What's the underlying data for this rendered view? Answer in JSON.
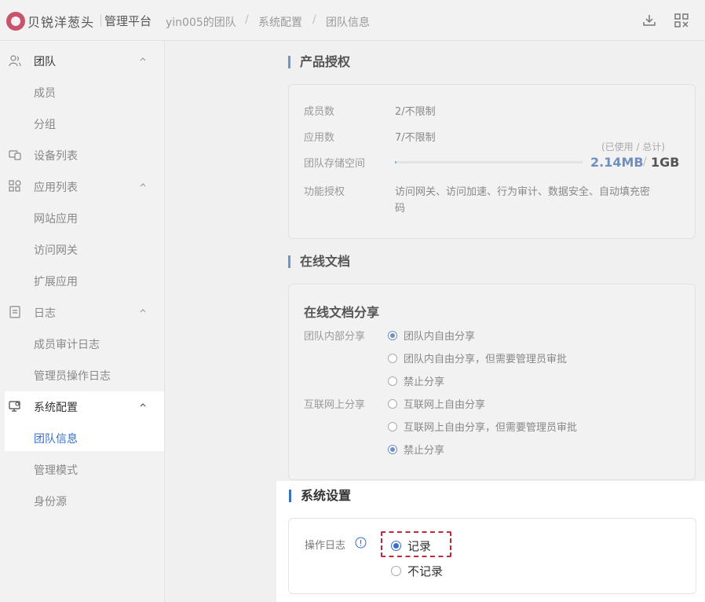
{
  "header": {
    "brand": "贝锐洋葱头",
    "platform": "管理平台",
    "breadcrumb": [
      "yin005的团队",
      "系统配置",
      "团队信息"
    ],
    "breadcrumb_sep": "/",
    "icons": [
      "download-icon",
      "qrcode-icon"
    ]
  },
  "sidebar": {
    "items": [
      {
        "label": "团队",
        "icon": "team-icon",
        "expandable": true
      },
      {
        "label": "成员"
      },
      {
        "label": "分组"
      },
      {
        "label": "设备列表",
        "icon": "devices-icon"
      },
      {
        "label": "应用列表",
        "icon": "apps-icon",
        "expandable": true
      },
      {
        "label": "网站应用"
      },
      {
        "label": "访问网关"
      },
      {
        "label": "扩展应用"
      },
      {
        "label": "日志",
        "icon": "log-icon",
        "expandable": true
      },
      {
        "label": "成员审计日志"
      },
      {
        "label": "管理员操作日志"
      },
      {
        "label": "系统配置",
        "icon": "system-config-icon",
        "expandable": true
      },
      {
        "label": "团队信息",
        "active": true
      },
      {
        "label": "管理模式"
      },
      {
        "label": "身份源"
      }
    ]
  },
  "license": {
    "title": "产品授权",
    "members_label": "成员数",
    "members_value": "2/不限制",
    "apps_label": "应用数",
    "apps_value": "7/不限制",
    "storage_label": "团队存储空间",
    "storage_caption": "(已使用 / 总计)",
    "storage_used": "2.14MB",
    "storage_slash": "/",
    "storage_total": "1GB",
    "storage_fraction": 0.002,
    "features_label": "功能授权",
    "features_value_line1": "访问网关、访问加速、行为审计、数据安全、自动填充密",
    "features_value_line2": "码"
  },
  "docs": {
    "title": "在线文档",
    "subtitle": "在线文档分享",
    "internal_label": "团队内部分享",
    "internal_options": [
      {
        "label": "团队内自由分享",
        "checked": true
      },
      {
        "label": "团队内自由分享，但需要管理员审批",
        "checked": false
      },
      {
        "label": "禁止分享",
        "checked": false
      }
    ],
    "internet_label": "互联网上分享",
    "internet_options": [
      {
        "label": "互联网上自由分享",
        "checked": false
      },
      {
        "label": "互联网上自由分享，但需要管理员审批",
        "checked": false
      },
      {
        "label": "禁止分享",
        "checked": true
      }
    ]
  },
  "system": {
    "title": "系统设置",
    "oplog_label": "操作日志",
    "oplog_options": [
      {
        "label": "记录",
        "checked": true
      },
      {
        "label": "不记录",
        "checked": false
      }
    ]
  },
  "colors": {
    "accent": "#3a6fc9",
    "highlight_border": "#c0283c"
  }
}
